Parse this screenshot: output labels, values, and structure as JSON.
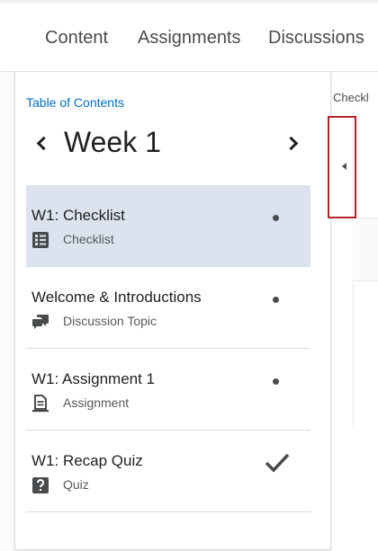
{
  "nav": {
    "items": [
      "Content",
      "Assignments",
      "Discussions"
    ]
  },
  "toc": {
    "heading_link": "Table of Contents",
    "week_title": "Week 1",
    "items": [
      {
        "title": "W1: Checklist",
        "type": "Checklist",
        "status": "dot",
        "active": true
      },
      {
        "title": "Welcome & Introductions",
        "type": "Discussion Topic",
        "status": "dot",
        "active": false
      },
      {
        "title": "W1: Assignment 1",
        "type": "Assignment",
        "status": "dot",
        "active": false
      },
      {
        "title": "W1: Recap Quiz",
        "type": "Quiz",
        "status": "check",
        "active": false
      }
    ]
  },
  "right_panel": {
    "title": "Checkl"
  },
  "colors": {
    "link": "#006fbf",
    "active_row": "#dce3ef",
    "highlight_border": "#b32429"
  }
}
